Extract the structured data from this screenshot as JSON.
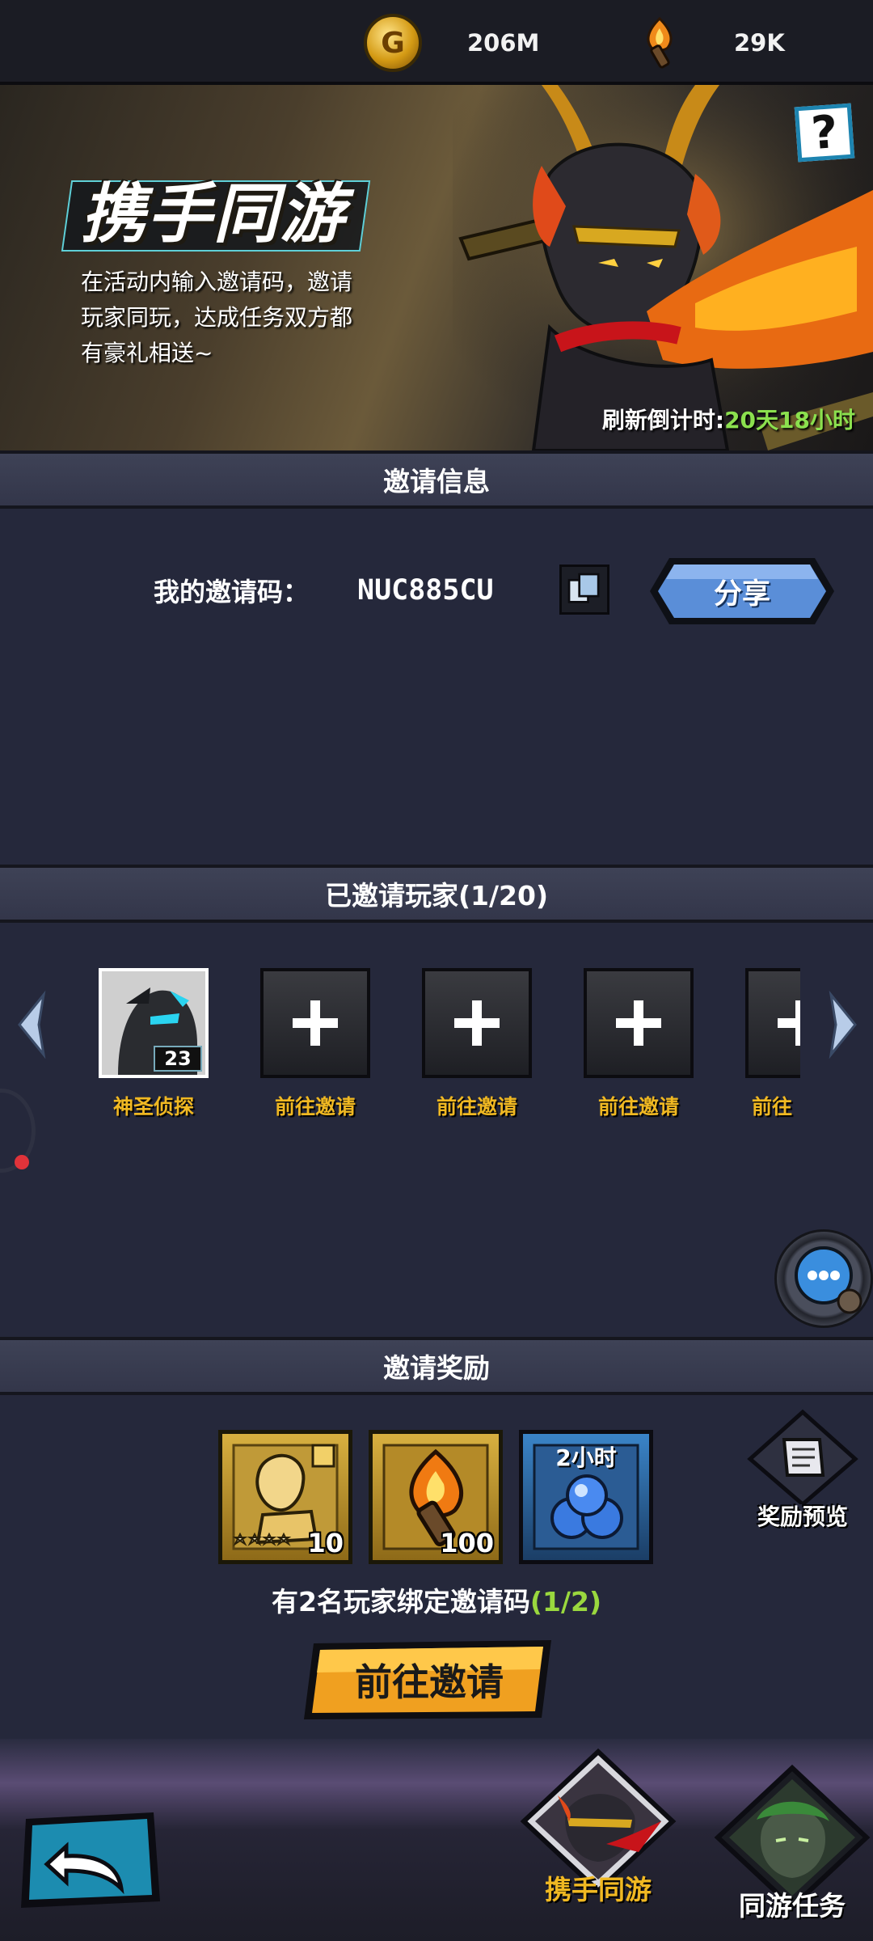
{
  "resources": {
    "coin": {
      "icon": "gold-coin-icon",
      "value": "206M"
    },
    "torch": {
      "icon": "torch-icon",
      "value": "29K"
    }
  },
  "banner": {
    "title": "携手同游",
    "description": "在活动内输入邀请码，邀请玩家同玩，达成任务双方都有豪礼相送~",
    "refresh_label": "刷新倒计时:",
    "refresh_time": "20天18小时",
    "help_label": "?"
  },
  "invite_info": {
    "header": "邀请信息",
    "code_label": "我的邀请码：",
    "code_value": "NUC885CU",
    "share_label": "分享"
  },
  "invited_players": {
    "header": "已邀请玩家(1/20)",
    "slots": [
      {
        "name": "神圣侦探",
        "level": "23",
        "filled": true
      },
      {
        "name": "前往邀请",
        "filled": false
      },
      {
        "name": "前往邀请",
        "filled": false
      },
      {
        "name": "前往邀请",
        "filled": false
      },
      {
        "name": "前往",
        "filled": false
      }
    ]
  },
  "rewards": {
    "header": "邀请奖励",
    "items": [
      {
        "icon": "hero-shard-icon",
        "count": "10",
        "stars": 5
      },
      {
        "icon": "torch-icon",
        "count": "100"
      },
      {
        "icon": "blue-orbs-icon",
        "tag": "2小时"
      }
    ],
    "preview_label": "奖励预览",
    "bind_text": "有2名玩家绑定邀请码",
    "bind_progress": "(1/2)",
    "invite_button": "前往邀请"
  },
  "tabs": {
    "active": "携手同游",
    "other": "同游任务"
  },
  "colors": {
    "accent_green": "#8be04e",
    "gold_text": "#f0b822",
    "progress_green": "#9ad83e",
    "share_blue": "#5a8ed8",
    "invite_orange": "#f0a020"
  }
}
